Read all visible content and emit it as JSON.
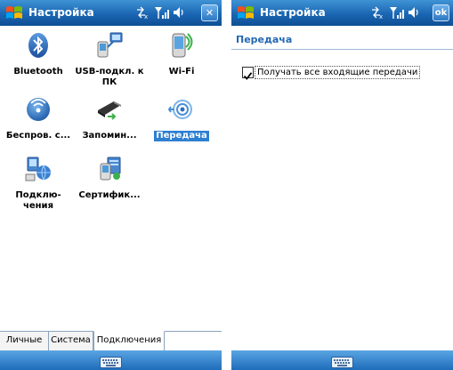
{
  "left_screen": {
    "title": "Настройка",
    "start_icon": "windows-start-icon",
    "close_button_label": "✕",
    "items": [
      {
        "label": "Bluetooth",
        "icon": "bluetooth-icon"
      },
      {
        "label": "USB-подкл. к ПК",
        "icon": "usb-pc-icon"
      },
      {
        "label": "Wi-Fi",
        "icon": "wifi-icon"
      },
      {
        "label": "Беспров. с...",
        "icon": "wireless-icon"
      },
      {
        "label": "Запомин...",
        "icon": "storage-card-icon"
      },
      {
        "label": "Передача",
        "icon": "beam-icon",
        "selected": true
      },
      {
        "label": "Подклю-чения",
        "icon": "connections-icon"
      },
      {
        "label": "Сертифик...",
        "icon": "certificates-icon"
      }
    ],
    "tabs": [
      {
        "label": "Личные"
      },
      {
        "label": "Система"
      },
      {
        "label": "Подключения",
        "active": true
      }
    ],
    "soft_key_icon": "keyboard-icon"
  },
  "right_screen": {
    "title": "Настройка",
    "ok_label": "ok",
    "section_title": "Передача",
    "checkbox_label": "Получать все входящие передачи",
    "checkbox_checked": true,
    "soft_key_icon": "keyboard-icon"
  },
  "colors": {
    "titlebar_top": "#3f93d4",
    "titlebar_bottom": "#0f4f94",
    "selection": "#2d7fd1",
    "section_title": "#2468b5"
  }
}
